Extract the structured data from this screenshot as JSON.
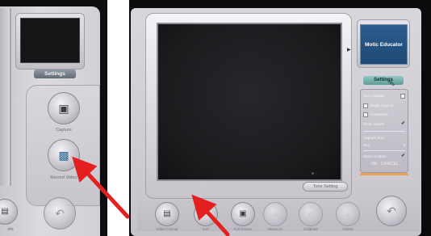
{
  "left_panel": {
    "settings_label": "Settings",
    "capture_label": "Capture",
    "record_video_label": "Record Video",
    "bottom_left_label": "nts"
  },
  "right_panel": {
    "thumbnail_title": "Motic Educator",
    "settings_label": "Settings",
    "tone_setting_label": "Tone Setting",
    "options": {
      "auto_capture": "Auto Capture",
      "single_capture": "Single  Capture",
      "continuous": "Continuous",
      "show_values": "Show Values",
      "capture_size": "Capture Size",
      "resolution": "Res",
      "save_location": "Save Location"
    },
    "ok_label": "OK",
    "cancel_label": "CANCEL",
    "bottom_buttons": [
      "Video Format",
      "Exit",
      "Full Screen",
      "Measure",
      "Calibrate",
      "Delete"
    ]
  },
  "colors": {
    "arrow": "#e31f1f",
    "thumb_blue": "#2c5d8f",
    "settings_teal": "#5e9c98",
    "accent_orange": "#e8a254"
  }
}
